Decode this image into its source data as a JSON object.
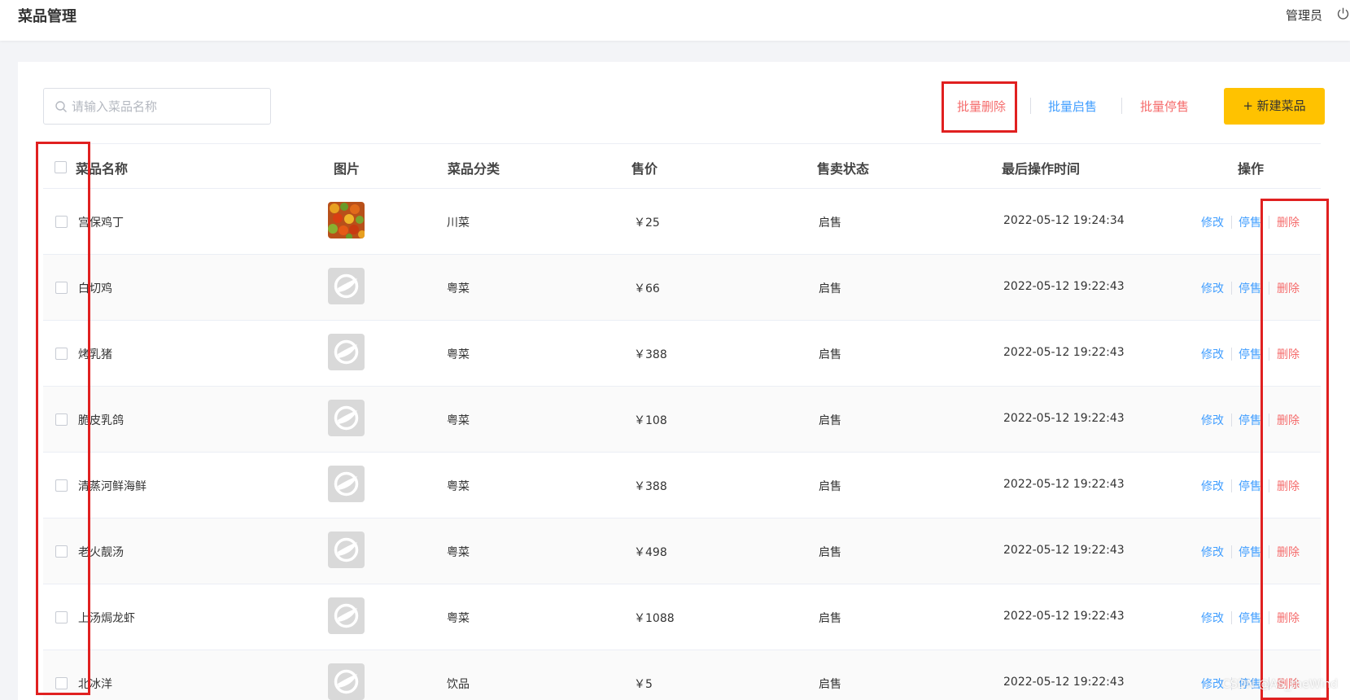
{
  "header": {
    "title": "菜品管理",
    "user": "管理员"
  },
  "search": {
    "placeholder": "请输入菜品名称",
    "value": ""
  },
  "toolbar": {
    "batch_delete": "批量删除",
    "batch_enable": "批量启售",
    "batch_disable": "批量停售",
    "new_dish": "+ 新建菜品"
  },
  "table": {
    "columns": [
      "菜品名称",
      "图片",
      "菜品分类",
      "售价",
      "售卖状态",
      "最后操作时间",
      "操作"
    ],
    "rows": [
      {
        "name": "宫保鸡丁",
        "category": "川菜",
        "price": "￥25",
        "status": "启售",
        "updated": "2022-05-12 19:24:34",
        "image": "food-photo"
      },
      {
        "name": "白切鸡",
        "category": "粤菜",
        "price": "￥66",
        "status": "启售",
        "updated": "2022-05-12 19:22:43",
        "image": "placeholder-logo"
      },
      {
        "name": "烤乳猪",
        "category": "粤菜",
        "price": "￥388",
        "status": "启售",
        "updated": "2022-05-12 19:22:43",
        "image": "placeholder-logo"
      },
      {
        "name": "脆皮乳鸽",
        "category": "粤菜",
        "price": "￥108",
        "status": "启售",
        "updated": "2022-05-12 19:22:43",
        "image": "placeholder-logo"
      },
      {
        "name": "清蒸河鲜海鲜",
        "category": "粤菜",
        "price": "￥388",
        "status": "启售",
        "updated": "2022-05-12 19:22:43",
        "image": "placeholder-logo"
      },
      {
        "name": "老火靓汤",
        "category": "粤菜",
        "price": "￥498",
        "status": "启售",
        "updated": "2022-05-12 19:22:43",
        "image": "placeholder-logo"
      },
      {
        "name": "上汤焗龙虾",
        "category": "粤菜",
        "price": "￥1088",
        "status": "启售",
        "updated": "2022-05-12 19:22:43",
        "image": "placeholder-logo"
      },
      {
        "name": "北冰洋",
        "category": "饮品",
        "price": "￥5",
        "status": "启售",
        "updated": "2022-05-12 19:22:43",
        "image": "placeholder-logo"
      }
    ],
    "actions": {
      "edit": "修改",
      "toggle": "停售",
      "delete": "删除"
    }
  },
  "watermark": "CSDN @AS_theWind",
  "colors": {
    "accent": "#ffc200",
    "link": "#419eff",
    "danger": "#f56c6c",
    "annotation": "#e02020"
  }
}
